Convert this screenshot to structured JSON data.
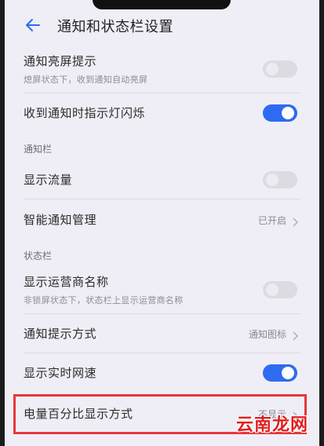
{
  "header": {
    "title": "通知和状态栏设置"
  },
  "rows": [
    {
      "title": "通知亮屏提示",
      "subtitle": "熄屏状态下，收到通知自动亮屏",
      "toggle": "off"
    },
    {
      "title": "收到通知时指示灯闪烁",
      "toggle": "on"
    },
    {
      "section": "通知栏"
    },
    {
      "title": "显示流量",
      "toggle": "off"
    },
    {
      "title": "智能通知管理",
      "value": "已开启"
    },
    {
      "section": "状态栏"
    },
    {
      "title": "显示运营商名称",
      "subtitle": "非锁屏状态下，状态栏上显示运营商名称",
      "toggle": "off"
    },
    {
      "title": "通知提示方式",
      "value": "通知图标"
    },
    {
      "title": "显示实时网速",
      "toggle": "on"
    },
    {
      "title": "电量百分比显示方式",
      "value": "不显示"
    }
  ],
  "watermark": "云南龙网",
  "colors": {
    "accent": "#2f6bf0",
    "highlight": "#e8363c",
    "background": "#efeef6"
  }
}
